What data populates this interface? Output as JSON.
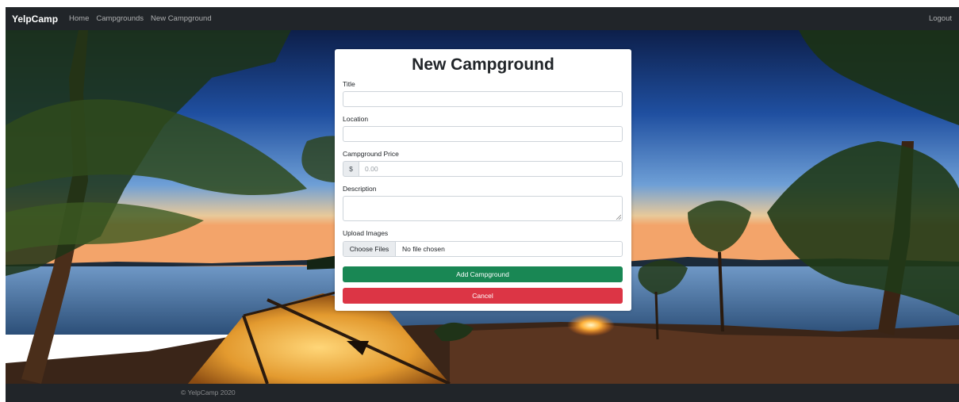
{
  "navbar": {
    "brand": "YelpCamp",
    "links": [
      "Home",
      "Campgrounds",
      "New Campground"
    ],
    "logout": "Logout"
  },
  "form": {
    "title": "New Campground",
    "title_label": "Title",
    "title_value": "",
    "location_label": "Location",
    "location_value": "",
    "price_label": "Campground Price",
    "price_addon": "$",
    "price_placeholder": "0.00",
    "description_label": "Description",
    "description_value": "",
    "upload_label": "Upload Images",
    "choose_files": "Choose Files",
    "no_file": "No file chosen",
    "submit": "Add Campground",
    "cancel": "Cancel"
  },
  "footer": {
    "copyright": "© YelpCamp 2020"
  },
  "colors": {
    "navbar_bg": "#212529",
    "success": "#198754",
    "danger": "#dc3545"
  }
}
